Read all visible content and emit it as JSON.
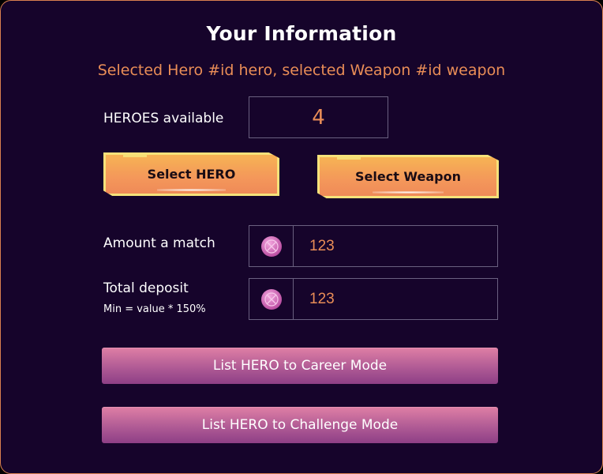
{
  "header": {
    "title": "Your Information",
    "subtitle": "Selected Hero #id hero, selected Weapon #id weapon"
  },
  "heroes": {
    "label": "HEROES available",
    "count": "4"
  },
  "buttons": {
    "select_hero": "Select HERO",
    "select_weapon": "Select Weapon",
    "list_career": "List HERO to Career Mode",
    "list_challenge": "List HERO to Challenge Mode"
  },
  "amount": {
    "label": "Amount a match",
    "value": "123",
    "icon": "token-coin-icon"
  },
  "deposit": {
    "label": "Total deposit",
    "hint": "Min = value * 150%",
    "value": "123",
    "icon": "token-coin-icon"
  },
  "colors": {
    "background": "#16042b",
    "accent": "#e98d57",
    "border": "#d9804f",
    "button_orange": "#f4975a",
    "button_pink": "#b05b95"
  }
}
